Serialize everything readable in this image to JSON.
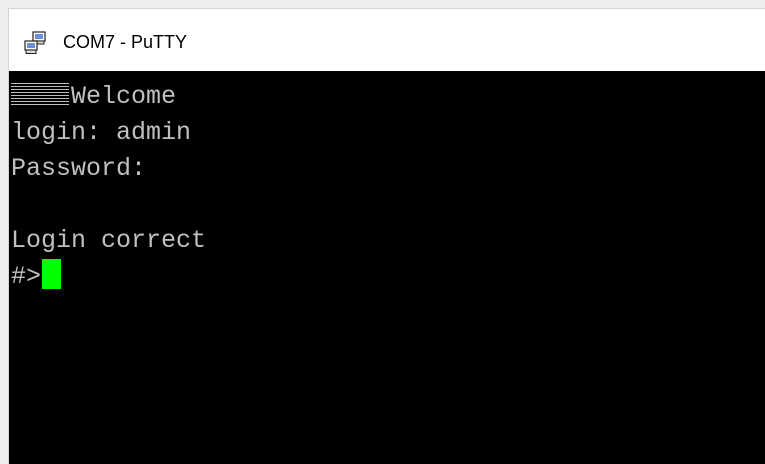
{
  "window": {
    "title": "COM7 - PuTTY",
    "icon": "putty-computers-icon"
  },
  "terminal": {
    "line1": "Welcome",
    "line2": "login: admin",
    "line3": "Password:",
    "line4": "",
    "line5": "Login correct",
    "prompt": "#>",
    "text_color": "#c0c0c0",
    "cursor_color": "#00ff00",
    "background": "#000000"
  }
}
